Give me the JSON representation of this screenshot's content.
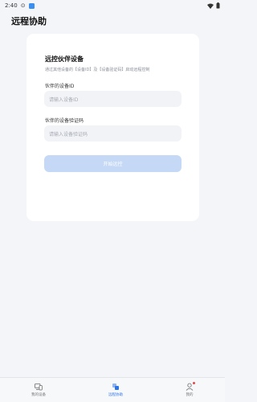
{
  "status_bar": {
    "time": "2:40",
    "icons": [
      "circle-icon",
      "app-icon",
      "wifi-icon",
      "battery-icon"
    ]
  },
  "header": {
    "title": "远程协助"
  },
  "card": {
    "title": "远控伙伴设备",
    "description": "通过其他设备的【设备ID】及【设备验证码】启动远程控制",
    "partner_id": {
      "label": "伙伴的设备ID",
      "placeholder": "请输入设备ID",
      "value": ""
    },
    "partner_code": {
      "label": "伙伴的设备验证码",
      "placeholder": "请输入设备验证码",
      "value": ""
    },
    "start_button": "开始远控"
  },
  "nav": {
    "items": [
      {
        "label": "我的设备",
        "icon": "devices-icon",
        "active": false
      },
      {
        "label": "远程协助",
        "icon": "remote-assist-icon",
        "active": true
      },
      {
        "label": "我的",
        "icon": "profile-icon",
        "active": false
      }
    ]
  },
  "colors": {
    "accent": "#2a74e6",
    "button_disabled": "#c5d9f6",
    "badge": "#e24a4a"
  }
}
